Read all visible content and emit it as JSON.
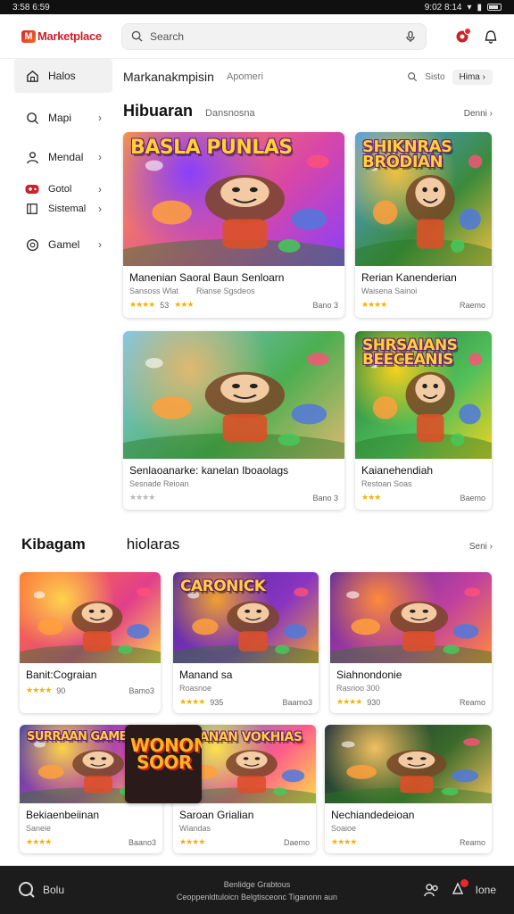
{
  "status": {
    "time": "3:58 6:59",
    "right_text": "9:02 8:14"
  },
  "header": {
    "logo": "Marketplace",
    "search_placeholder": "Search",
    "icons": [
      "mic-icon",
      "notification-icon",
      "account-icon"
    ]
  },
  "sidebar": {
    "items": [
      {
        "label": "Halos",
        "icon": "home-icon"
      },
      {
        "label": "Mapi",
        "icon": "search-icon"
      },
      {
        "label": "Mendal",
        "icon": "user-icon"
      },
      {
        "label": "Gotol",
        "icon": "gamepad-icon"
      },
      {
        "label": "Sistemal",
        "icon": "book-icon"
      },
      {
        "label": "Gamel",
        "icon": "games-icon"
      }
    ]
  },
  "subnav": {
    "title": "Markanakmpisin",
    "sub": "Apomeri",
    "right_label": "Sisto",
    "pill": "Hima"
  },
  "section1": {
    "title": "Hibuaran",
    "sub": "Dansnosna",
    "more": "Denni",
    "cards": [
      {
        "title": "Manenian Saoral Baun Senloarn",
        "sub1": "Sansoss Wlat",
        "sub2": "Rianse Sgsdeos",
        "rating": 4,
        "count": "53",
        "rating2": 3,
        "end": "Bano 3",
        "art_title": "Basla Punlas",
        "colors": [
          "#ff9a3c",
          "#d946a8",
          "#8a3ffc"
        ]
      },
      {
        "title": "Rerian Kanenderian",
        "sub1": "Waisena Sainoi",
        "sub2": "",
        "rating": 4,
        "count": "",
        "rating2": 0,
        "end": "Raemo",
        "art_title": "Shiknras Brodian",
        "colors": [
          "#4aa0f0",
          "#3c8a3a",
          "#f0c040"
        ]
      },
      {
        "title": "Senlaoanarke: kanelan Iboaolags",
        "sub1": "Sesnade Reioan",
        "sub2": "",
        "rating": 0,
        "count": "",
        "rating2": 0,
        "end": "Bano 3",
        "art_title": "",
        "colors": [
          "#7ec8f0",
          "#4caf50",
          "#e0b870"
        ]
      },
      {
        "title": "Kaianehendiah",
        "sub1": "Restoan Soas",
        "sub2": "",
        "rating": 3,
        "count": "",
        "rating2": 0,
        "end": "Baemo",
        "art_title": "Shrsaians Beeceanis",
        "colors": [
          "#1f7a3a",
          "#52c05a",
          "#f5d21f"
        ]
      }
    ]
  },
  "section2": {
    "title": "Kibagam",
    "sub": "hiolaras",
    "more": "Seni",
    "row1": [
      {
        "title": "Banit:Cograian",
        "sub1": "",
        "rating": 4,
        "count": "90",
        "end": "Bamo3",
        "art_title": "",
        "colors": [
          "#ff7a2f",
          "#e23f8a",
          "#ffd34a"
        ]
      },
      {
        "title": "Manand sa",
        "sub1": "Roasnoe",
        "rating": 4,
        "count": "935",
        "end": "Baamo3",
        "art_title": "Caronick",
        "colors": [
          "#4b2a9a",
          "#8a34c2",
          "#f0a030"
        ]
      },
      {
        "title": "Siahnondonie",
        "sub1": "Rasrioo 300",
        "rating": 4,
        "count": "930",
        "end": "Reamo",
        "art_title": "",
        "colors": [
          "#5a2aa0",
          "#c040a0",
          "#ff8a3a"
        ]
      }
    ],
    "row2": [
      {
        "title": "Bekiaenbeiinan",
        "sub1": "Saneie",
        "rating": 4,
        "count": "",
        "end": "Baano3",
        "art_title": "Surraan Game",
        "colors": [
          "#3a3aa8",
          "#c24aa8",
          "#ffd24a"
        ]
      },
      {
        "title": "Saroan Grialian",
        "sub1": "Wiandas",
        "rating": 4,
        "count": "",
        "end": "Daemo",
        "art_title": "Granan Vokhias",
        "colors": [
          "#2a9ad0",
          "#ff5a8a",
          "#ffe04a"
        ]
      },
      {
        "title": "Nechiandedeioan",
        "sub1": "Soaioe",
        "rating": 4,
        "count": "",
        "end": "Reamo",
        "art_title": "",
        "colors": [
          "#1a2a3a",
          "#3a6a2a",
          "#f0c060"
        ]
      }
    ],
    "wonder_tile": "Wonon Soor"
  },
  "bottom": {
    "left_label": "Bolu",
    "center_line1": "Benlidge Grabtous",
    "center_line2": "Ceoppenldtuloicn Belgtisceonc Tiganonn aun",
    "right_label": "Ione"
  },
  "colors": {
    "accent_red": "#c7232a",
    "star": "#f5b301",
    "bottom_bg": "#1c1c1c"
  }
}
